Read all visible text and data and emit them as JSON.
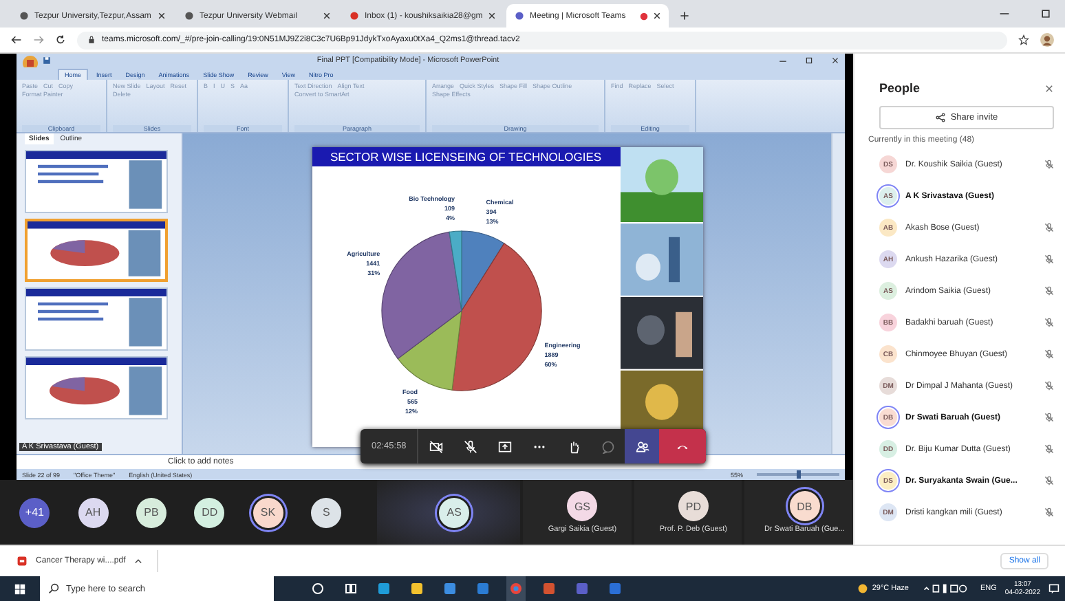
{
  "browser": {
    "tabs": [
      {
        "title": "Tezpur University,Tezpur,Assam",
        "selected": false,
        "recording": false
      },
      {
        "title": "Tezpur University Webmail",
        "selected": false,
        "recording": false
      },
      {
        "title": "Inbox (1) - koushiksaikia28@gm",
        "selected": false,
        "recording": false
      },
      {
        "title": "Meeting | Microsoft Teams",
        "selected": true,
        "recording": true
      }
    ],
    "url": "teams.microsoft.com/_#/pre-join-calling/19:0N51MJ9Z2i8C3c7U6Bp91JdykTxoAyaxu0tXa4_Q2ms1@thread.tacv2"
  },
  "powerpoint": {
    "title": "Final PPT [Compatibility Mode] - Microsoft PowerPoint",
    "ribbon_tabs": [
      {
        "label": "Home",
        "selected": true
      },
      {
        "label": "Insert",
        "selected": false
      },
      {
        "label": "Design",
        "selected": false
      },
      {
        "label": "Animations",
        "selected": false
      },
      {
        "label": "Slide Show",
        "selected": false
      },
      {
        "label": "Review",
        "selected": false
      },
      {
        "label": "View",
        "selected": false
      },
      {
        "label": "Nitro Pro",
        "selected": false
      }
    ],
    "ribbon_groups": [
      {
        "label": "Clipboard",
        "buttons": [
          "Paste",
          "Cut",
          "Copy",
          "Format Painter"
        ]
      },
      {
        "label": "Slides",
        "buttons": [
          "New Slide",
          "Layout",
          "Reset",
          "Delete"
        ]
      },
      {
        "label": "Font",
        "buttons": [
          "B",
          "I",
          "U",
          "S",
          "Aa"
        ]
      },
      {
        "label": "Paragraph",
        "buttons": [
          "Text Direction",
          "Align Text",
          "Convert to SmartArt"
        ]
      },
      {
        "label": "Drawing",
        "buttons": [
          "Arrange",
          "Quick Styles",
          "Shape Fill",
          "Shape Outline",
          "Shape Effects"
        ]
      },
      {
        "label": "Editing",
        "buttons": [
          "Find",
          "Replace",
          "Select"
        ]
      }
    ],
    "pane_tabs": [
      {
        "label": "Slides",
        "selected": true
      },
      {
        "label": "Outline",
        "selected": false
      }
    ],
    "thumbnails": [
      {
        "selected": false
      },
      {
        "selected": true
      },
      {
        "selected": false
      },
      {
        "selected": false
      }
    ],
    "slide": {
      "chart_data": {
        "type": "pie",
        "title": "SECTOR WISE LICENSEING OF TECHNOLOGIES",
        "categories": [
          "Chemical",
          "Engineering",
          "Food",
          "Agriculture",
          "Bio Technology"
        ],
        "values": [
          394,
          1889,
          565,
          1441,
          109
        ],
        "value_labels": [
          "394",
          "1889",
          "565",
          "1441",
          "109"
        ],
        "annotations": [
          {
            "text": "13%"
          },
          {
            "text": "60%"
          },
          {
            "text": "12%"
          },
          {
            "text": "31%"
          },
          {
            "text": "4%"
          }
        ],
        "data_labels": true
      }
    },
    "notes_placeholder": "Click to add notes",
    "status": [
      "Slide 22 of 99",
      "\"Office Theme\"",
      "English (United States)"
    ],
    "zoom": "55%",
    "zoom_slider": {
      "level": 0.5
    }
  },
  "presenter_label": "A K Srivastava (Guest)",
  "call_controls": {
    "timer": "02:45:58",
    "buttons": [
      {
        "kind": "camera-off",
        "selected": false
      },
      {
        "kind": "mic-off",
        "selected": false
      },
      {
        "kind": "share",
        "selected": false
      },
      {
        "kind": "more",
        "selected": false
      },
      {
        "kind": "hand",
        "selected": false
      },
      {
        "kind": "chat",
        "selected": false
      },
      {
        "kind": "people",
        "selected": true
      },
      {
        "kind": "hangup",
        "selected": false
      }
    ]
  },
  "participants": [
    {
      "initials": "+41",
      "color": "#5b5fc7",
      "active": false
    },
    {
      "initials": "AH",
      "color": "#dcd9f0",
      "active": false
    },
    {
      "initials": "PB",
      "color": "#d7ecdc",
      "active": false
    },
    {
      "initials": "DD",
      "color": "#d3efe0",
      "active": false
    },
    {
      "initials": "SK",
      "color": "#f9d8cc",
      "active": true
    },
    {
      "initials": "S",
      "color": "#dde3e8",
      "active": false
    },
    {
      "initials": "AS",
      "color": "#d9eeea",
      "active": true
    },
    {
      "initials": "GS",
      "color": "#f3d9e6",
      "active": false,
      "name": "Gargi Saikia (Guest)"
    },
    {
      "initials": "PD",
      "color": "#e8ddd8",
      "active": false,
      "name": "Prof. P. Deb (Guest)"
    },
    {
      "initials": "DB",
      "color": "#f9dccf",
      "active": true,
      "name": "Dr Swati Baruah (Gue..."
    }
  ],
  "people": {
    "title": "People",
    "share": "Share invite",
    "section": "Currently in this meeting (48)",
    "members": [
      {
        "initials": "DS",
        "name": "Dr. Koushik Saikia (Guest)",
        "color": "#f6d7d5",
        "speaking": false,
        "muted": true
      },
      {
        "initials": "AS",
        "name": "A K Srivastava (Guest)",
        "color": "#dcefed",
        "speaking": true,
        "muted": false
      },
      {
        "initials": "AB",
        "name": "Akash Bose (Guest)",
        "color": "#fbe8c4",
        "speaking": false,
        "muted": true
      },
      {
        "initials": "AH",
        "name": "Ankush Hazarika (Guest)",
        "color": "#dcd9f0",
        "speaking": false,
        "muted": true
      },
      {
        "initials": "AS",
        "name": "Arindom Saikia (Guest)",
        "color": "#dcefdf",
        "speaking": false,
        "muted": true
      },
      {
        "initials": "BB",
        "name": "Badakhi baruah (Guest)",
        "color": "#f8d3dc",
        "speaking": false,
        "muted": true
      },
      {
        "initials": "CB",
        "name": "Chinmoyee Bhuyan (Guest)",
        "color": "#fbe3cd",
        "speaking": false,
        "muted": true
      },
      {
        "initials": "DM",
        "name": "Dr Dimpal J Mahanta (Guest)",
        "color": "#e7dcd9",
        "speaking": false,
        "muted": true
      },
      {
        "initials": "DB",
        "name": "Dr Swati Baruah (Guest)",
        "color": "#f9dcd2",
        "speaking": true,
        "muted": true
      },
      {
        "initials": "DD",
        "name": "Dr. Biju Kumar Dutta (Guest)",
        "color": "#d7efe3",
        "speaking": false,
        "muted": true
      },
      {
        "initials": "DS",
        "name": "Dr. Suryakanta Swain (Gue...",
        "color": "#fbeec3",
        "speaking": true,
        "muted": true
      },
      {
        "initials": "DM",
        "name": "Dristi kangkan mili (Guest)",
        "color": "#dde6f4",
        "speaking": false,
        "muted": true
      }
    ]
  },
  "download": {
    "file": "Cancer Therapy wi....pdf",
    "show_all": "Show all"
  },
  "taskbar": {
    "search_placeholder": "Type here to search",
    "weather": "29°C Haze",
    "language": "ENG",
    "time": "13:07",
    "date": "04-02-2022"
  }
}
